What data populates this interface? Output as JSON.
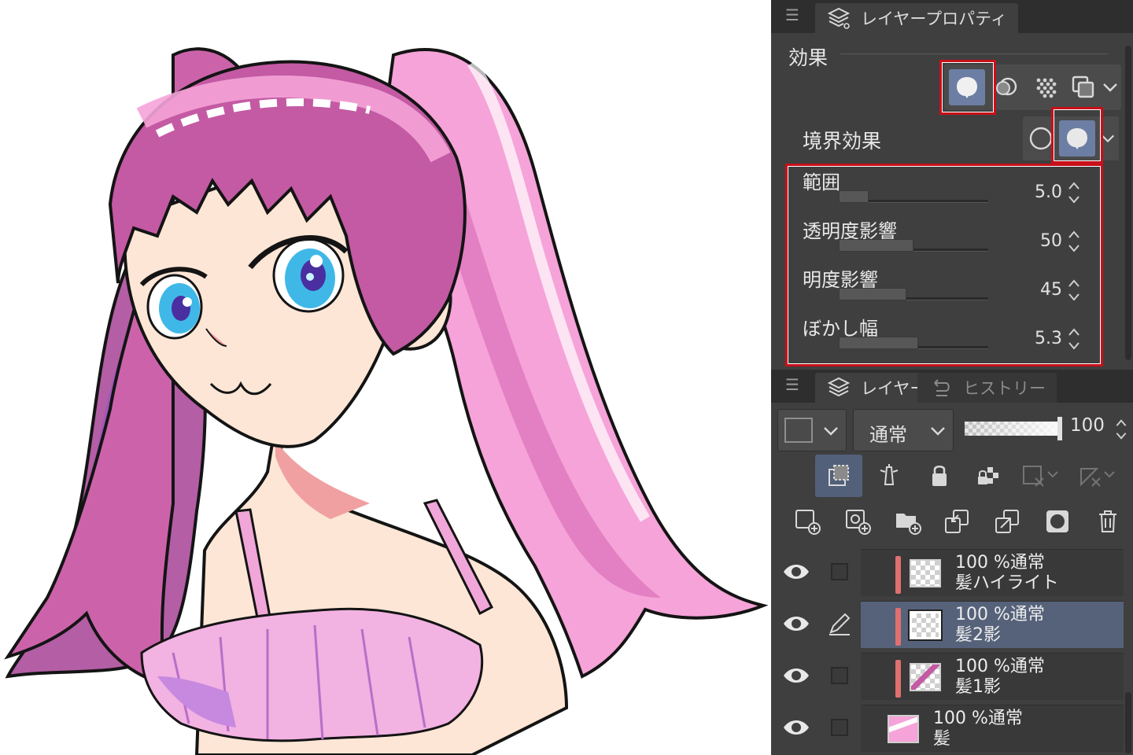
{
  "panel": {
    "property_tab": {
      "label": "レイヤープロパティ"
    },
    "effects": {
      "title": "効果",
      "buttons": [
        "boundary-effect",
        "tone",
        "halftone",
        "layer-color"
      ]
    },
    "boundary": {
      "label": "境界効果",
      "options": [
        "border",
        "watercolor-edge"
      ]
    },
    "params": [
      {
        "label": "範囲",
        "value": "5.0",
        "fill": 0.2
      },
      {
        "label": "透明度影響",
        "value": "50",
        "fill": 0.5
      },
      {
        "label": "明度影響",
        "value": "45",
        "fill": 0.45
      },
      {
        "label": "ぼかし幅",
        "value": "5.3",
        "fill": 0.53
      }
    ],
    "layer_tabs": {
      "layer": "レイヤー",
      "history": "ヒストリー"
    },
    "layer_toolbar": {
      "blend_mode": "通常",
      "opacity": "100"
    },
    "layers": [
      {
        "opacity_mode": "100 %通常",
        "name": "髪ハイライト",
        "clipped": true,
        "selected": false
      },
      {
        "opacity_mode": "100 %通常",
        "name": "髪2影",
        "clipped": true,
        "selected": true
      },
      {
        "opacity_mode": "100 %通常",
        "name": "髪1影",
        "clipped": true,
        "selected": false
      },
      {
        "opacity_mode": "100 %通常",
        "name": "髪",
        "clipped": false,
        "selected": false
      }
    ],
    "colors": {
      "accent": "#6c7ea4",
      "highlight_box": "#c8101a",
      "clip_bar": "#e07070",
      "panel_bg": "#3f3f3f"
    }
  }
}
